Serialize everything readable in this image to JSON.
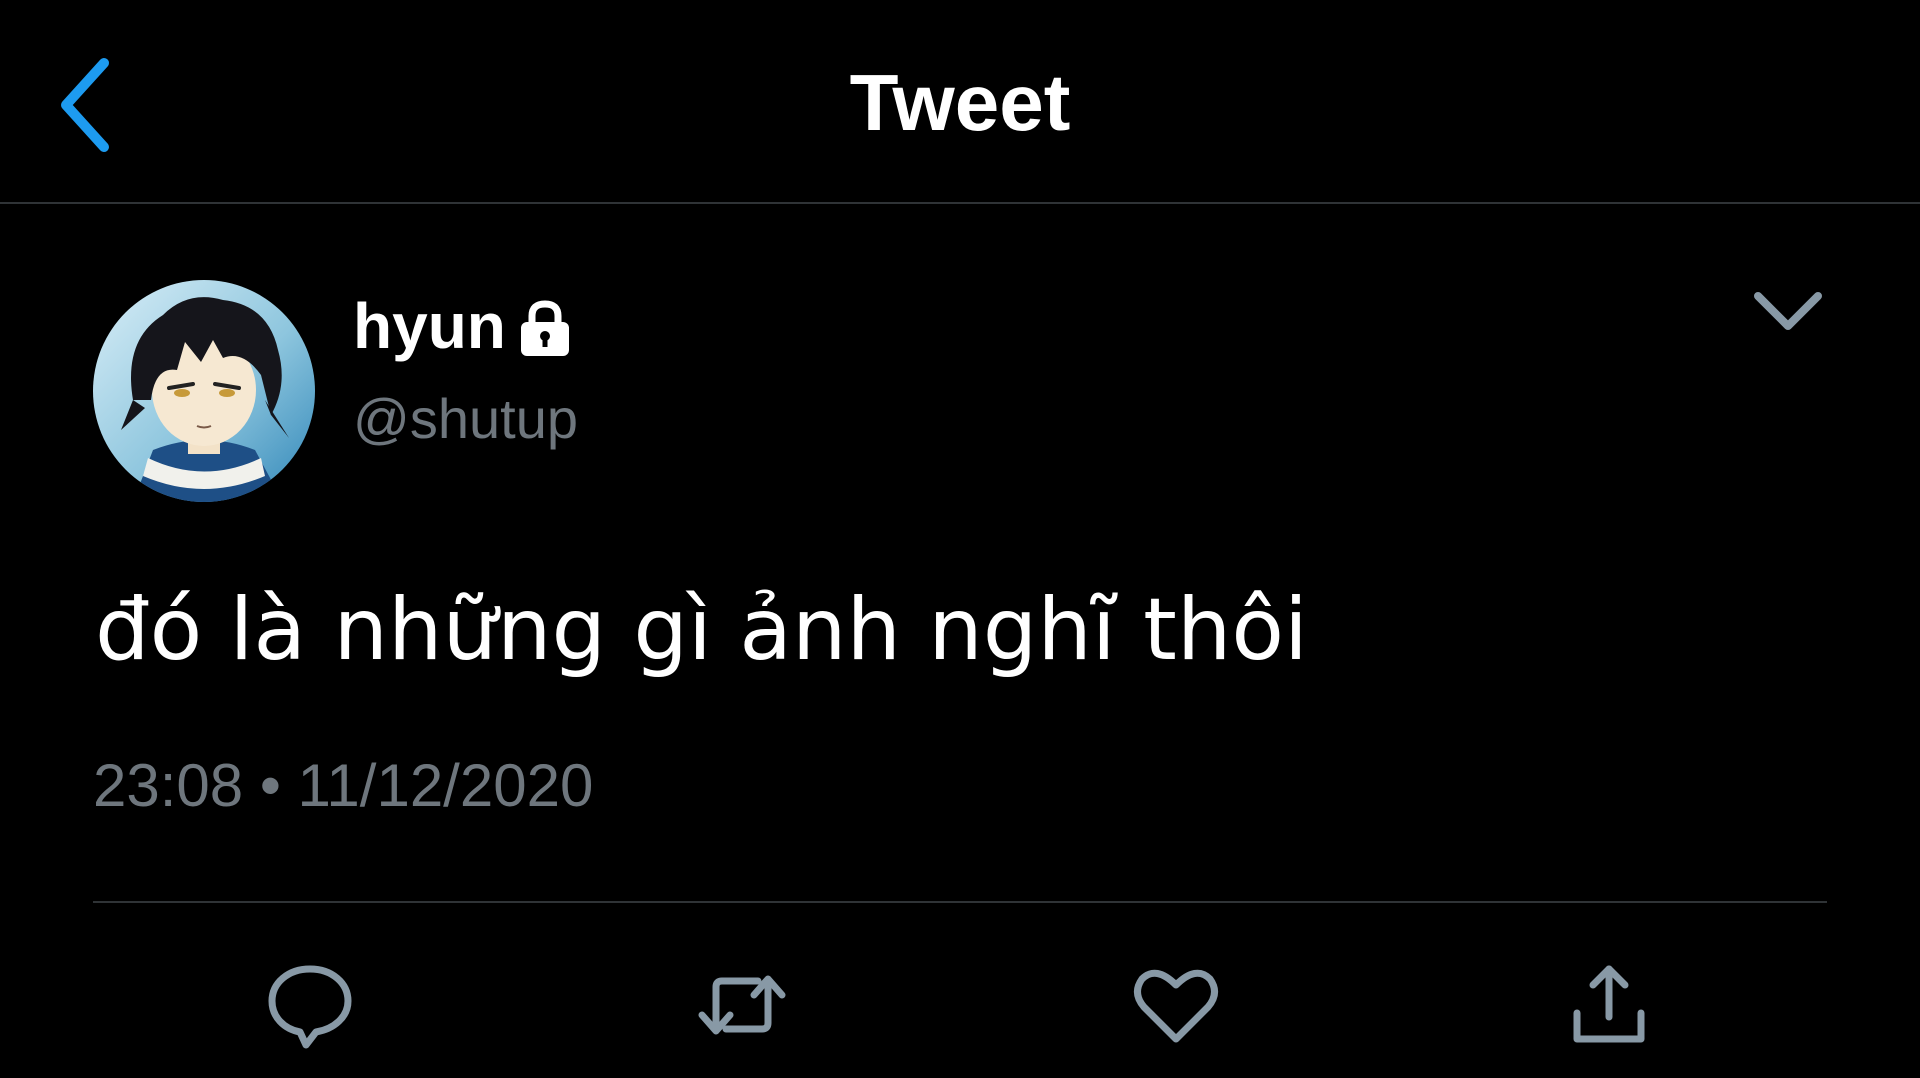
{
  "header": {
    "title": "Tweet",
    "back_icon": "chevron-left-icon"
  },
  "colors": {
    "background": "#000000",
    "accent": "#1d9bf0",
    "secondary_text": "#6e767d",
    "divider": "#2f3336",
    "icon": "#8899a6"
  },
  "tweet": {
    "author": {
      "display_name": "hyun",
      "handle": "@shutup",
      "protected_icon": "lock-icon",
      "avatar": "anime-character-avatar"
    },
    "menu_icon": "chevron-down-icon",
    "text": "đó là những gì ảnh nghĩ thôi",
    "timestamp": "23:08 • 11/12/2020"
  },
  "actions": [
    {
      "name": "reply",
      "icon": "reply-icon"
    },
    {
      "name": "retweet",
      "icon": "retweet-icon"
    },
    {
      "name": "like",
      "icon": "heart-icon"
    },
    {
      "name": "share",
      "icon": "share-icon"
    }
  ]
}
